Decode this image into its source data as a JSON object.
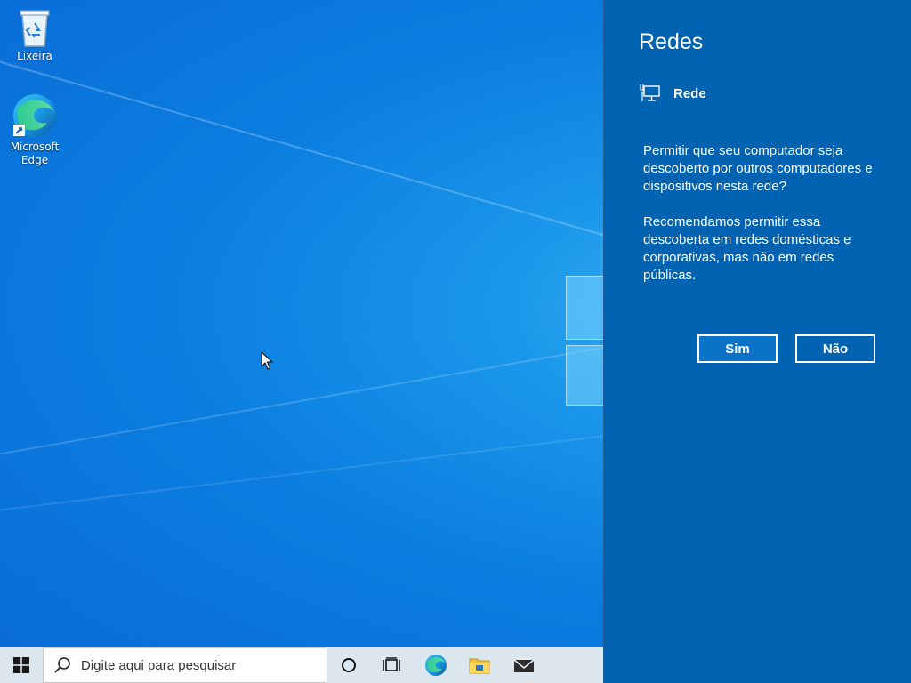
{
  "desktop": {
    "icons": [
      {
        "label": "Lixeira",
        "icon": "recycle-bin-icon"
      },
      {
        "label": "Microsoft Edge",
        "icon": "edge-icon"
      }
    ]
  },
  "taskbar": {
    "search_placeholder": "Digite aqui para pesquisar",
    "items": [
      "start-icon",
      "search-icon",
      "cortana-icon",
      "task-view-icon",
      "edge-icon",
      "file-explorer-icon",
      "mail-icon"
    ]
  },
  "network_panel": {
    "title": "Redes",
    "network_icon": "wired-network-icon",
    "network_name": "Rede",
    "question": "Permitir que seu computador seja descoberto por outros computadores e dispositivos nesta rede?",
    "recommendation": "Recomendamos permitir essa descoberta em redes domésticas e corporativas, mas não em redes públicas.",
    "yes_label": "Sim",
    "no_label": "Não"
  },
  "colors": {
    "panel_bg": "#0063b1",
    "taskbar_bg": "#dbe6ef",
    "desktop_accent": "#0b7ee0"
  }
}
